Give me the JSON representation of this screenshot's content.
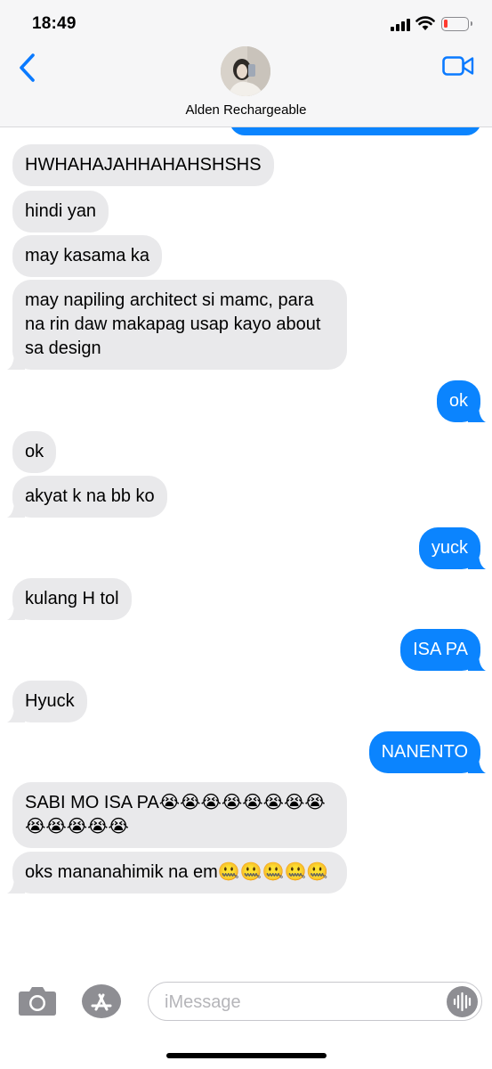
{
  "status_bar": {
    "time": "18:49"
  },
  "header": {
    "contact_name": "Alden Rechargeable"
  },
  "messages": [
    {
      "dir": "in",
      "text": "HWHAHAJAHHAHAHSHSHS"
    },
    {
      "dir": "in",
      "text": "hindi yan"
    },
    {
      "dir": "in",
      "text": "may kasama ka"
    },
    {
      "dir": "in",
      "text": "may napiling architect si mamc, para na rin daw makapag usap kayo about sa design"
    },
    {
      "dir": "out",
      "text": "ok"
    },
    {
      "dir": "in",
      "text": "ok"
    },
    {
      "dir": "in",
      "text": "akyat k na bb ko"
    },
    {
      "dir": "out",
      "text": "yuck"
    },
    {
      "dir": "in",
      "text": "kulang H tol"
    },
    {
      "dir": "out",
      "text": "ISA PA"
    },
    {
      "dir": "in",
      "text": "Hyuck"
    },
    {
      "dir": "out",
      "text": "NANENTO"
    },
    {
      "dir": "in",
      "text": "SABI MO ISA PA😭😭😭😭😭😭😭😭😭😭😭😭😭"
    },
    {
      "dir": "in",
      "text": "oks mananahimik na em🤐🤐🤐🤐🤐"
    }
  ],
  "composer": {
    "placeholder": "iMessage"
  },
  "icons": {
    "back": "chevron-left-icon",
    "video": "video-camera-icon",
    "camera": "camera-icon",
    "appstore": "app-store-icon",
    "audio": "audio-waveform-icon"
  },
  "colors": {
    "outgoing_bubble": "#0b84fe",
    "incoming_bubble": "#e9e9eb",
    "accent": "#0a7aff",
    "header_bg": "#f6f6f7"
  }
}
